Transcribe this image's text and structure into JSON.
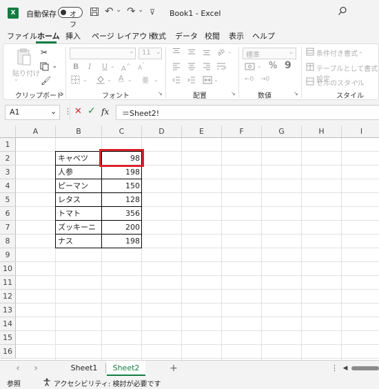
{
  "titlebar": {
    "logo": "X",
    "autosave_label": "自動保存",
    "toggle_text": "オフ",
    "save_icon": "save-icon",
    "undo_icon": "↶",
    "redo_icon": "↷",
    "dropdown_caret": "⌄",
    "customize_icon": "⊽",
    "doc_title": "Book1  -  Excel",
    "search_icon": "⚲"
  },
  "ribbon_tabs": [
    "ファイル",
    "ホーム",
    "挿入",
    "ページ レイアウト",
    "数式",
    "データ",
    "校閲",
    "表示",
    "ヘルプ"
  ],
  "ribbon": {
    "clipboard": {
      "paste": "貼り付け",
      "label": "クリップボード"
    },
    "font": {
      "size": "11",
      "bold": "B",
      "italic": "I",
      "underline": "U",
      "font_color": "A",
      "label": "フォント"
    },
    "alignment": {
      "label": "配置"
    },
    "number": {
      "format": "標準",
      "percent": "%",
      "comma": "9",
      "label": "数値"
    },
    "styles": {
      "conditional": "条件付き書式",
      "table": "テーブルとして書式設定",
      "cell_styles": "セルのスタイル",
      "label": "スタイル"
    }
  },
  "formula_bar": {
    "name_box": "A1",
    "cancel": "✕",
    "enter": "✓",
    "fx": "fx",
    "formula": "＝Sheet2!"
  },
  "grid": {
    "columns": [
      "A",
      "B",
      "C",
      "D",
      "E",
      "F",
      "G",
      "H",
      "I"
    ],
    "rows": [
      "1",
      "2",
      "3",
      "4",
      "5",
      "6",
      "7",
      "8",
      "9",
      "10",
      "11",
      "12",
      "13",
      "14",
      "15",
      "16"
    ],
    "table": [
      {
        "name": "キャベツ",
        "value": "98"
      },
      {
        "name": "人参",
        "value": "198"
      },
      {
        "name": "ピーマン",
        "value": "150"
      },
      {
        "name": "レタス",
        "value": "128"
      },
      {
        "name": "トマト",
        "value": "356"
      },
      {
        "name": "ズッキーニ",
        "value": "200"
      },
      {
        "name": "ナス",
        "value": "198"
      }
    ],
    "highlight_color": "#d9232a"
  },
  "sheets": {
    "prev": "‹",
    "next": "›",
    "tabs": [
      "Sheet1",
      "Sheet2"
    ],
    "active": "Sheet2",
    "add": "+",
    "more": "⋮"
  },
  "status": {
    "mode": "参照",
    "accessibility": "アクセシビリティ: 検討が必要です"
  },
  "accent_color": "#107c41"
}
